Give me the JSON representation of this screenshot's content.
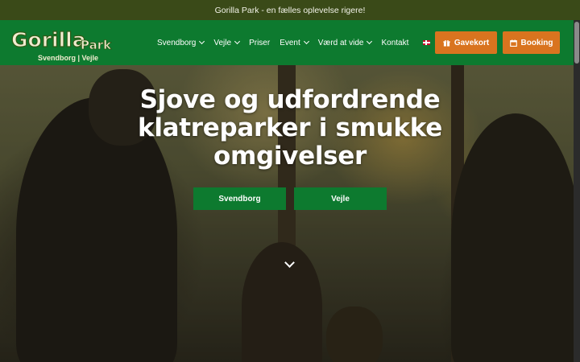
{
  "announcement": "Gorilla Park - en fælles oplevelse rigere!",
  "logo": {
    "brand_main": "Gorilla",
    "brand_sub": "Park",
    "tagline": "Svendborg | Vejle"
  },
  "nav": {
    "items": [
      {
        "label": "Svendborg",
        "dropdown": true
      },
      {
        "label": "Vejle",
        "dropdown": true
      },
      {
        "label": "Priser",
        "dropdown": false
      },
      {
        "label": "Event",
        "dropdown": true
      },
      {
        "label": "Værd at vide",
        "dropdown": true
      },
      {
        "label": "Kontakt",
        "dropdown": false
      }
    ],
    "language_icon": "danish-flag-icon",
    "gift_button": "Gavekort",
    "booking_button": "Booking"
  },
  "hero": {
    "headline_lines": [
      "Sjove og udfordrende",
      "klatreparker i smukke",
      "omgivelser"
    ],
    "buttons": [
      "Svendborg",
      "Vejle"
    ],
    "scroll_icon": "chevron-down-icon"
  },
  "colors": {
    "brand_green": "#0d7a2f",
    "accent_orange": "#d9741f",
    "topbar": "#3a4a18"
  }
}
